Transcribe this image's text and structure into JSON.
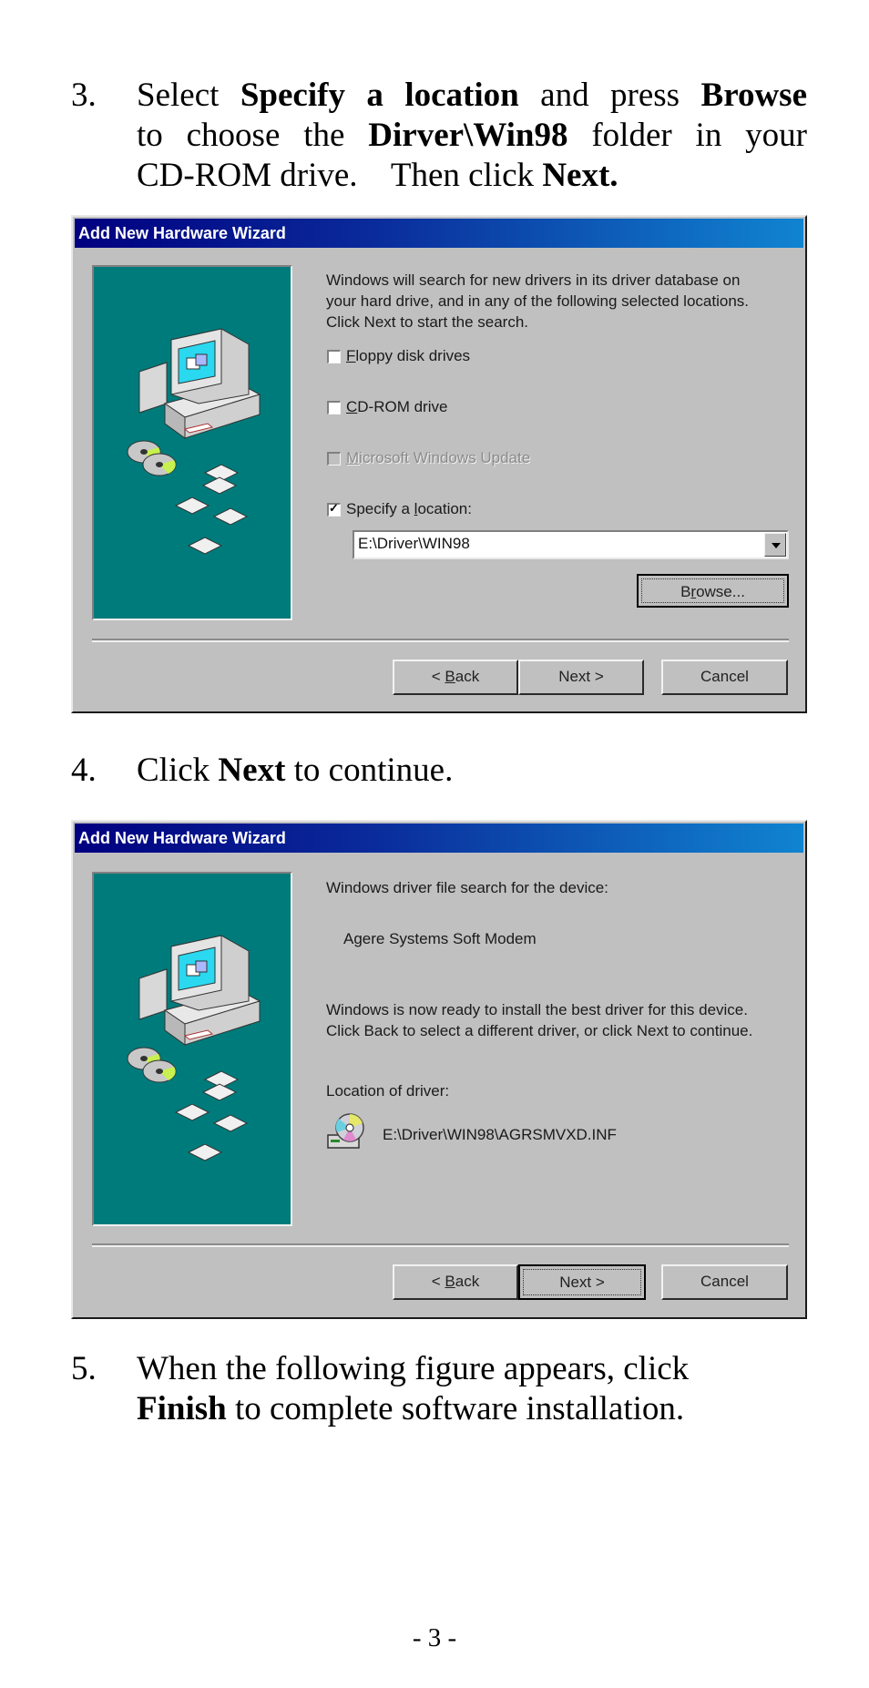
{
  "steps": [
    {
      "number": "3.",
      "lines": [
        {
          "parts": [
            {
              "t": "Select ",
              "b": false
            },
            {
              "t": "Specify a location",
              "b": true
            },
            {
              "t": " and press ",
              "b": false
            },
            {
              "t": "Browse",
              "b": true
            }
          ]
        },
        {
          "parts": [
            {
              "t": "to choose the ",
              "b": false
            },
            {
              "t": "Dirver\\Win98",
              "b": true
            },
            {
              "t": " folder in your",
              "b": false
            }
          ]
        },
        {
          "parts": [
            {
              "t": "CD-ROM drive.    Then click ",
              "b": false
            },
            {
              "t": "Next.",
              "b": true
            }
          ]
        }
      ]
    },
    {
      "number": "4.",
      "lines": [
        {
          "parts": [
            {
              "t": "Click ",
              "b": false
            },
            {
              "t": "Next",
              "b": true
            },
            {
              "t": " to continue.",
              "b": false
            }
          ]
        }
      ]
    },
    {
      "number": "5.",
      "lines": [
        {
          "parts": [
            {
              "t": "When the following figure appears, click",
              "b": false
            }
          ]
        },
        {
          "parts": [
            {
              "t": "Finish",
              "b": true
            },
            {
              "t": " to complete software installation.",
              "b": false
            }
          ]
        }
      ]
    }
  ],
  "dialog1": {
    "title": "Add New Hardware Wizard",
    "intro_lines": [
      "Windows will search for new drivers in its driver database on",
      "your hard drive, and in any of the following selected locations.",
      "Click Next to start the search."
    ],
    "options": [
      {
        "label_pre": "",
        "accel": "F",
        "label_post": "loppy disk drives",
        "checked": false,
        "disabled": false
      },
      {
        "label_pre": "",
        "accel": "C",
        "label_post": "D-ROM drive",
        "checked": false,
        "disabled": false
      },
      {
        "label_pre": "",
        "accel": "M",
        "label_post": "icrosoft Windows Update",
        "checked": false,
        "disabled": true
      },
      {
        "label_pre": "Specify a ",
        "accel": "l",
        "label_post": "ocation:",
        "checked": true,
        "disabled": false
      }
    ],
    "location_value": "E:\\Driver\\WIN98",
    "browse": {
      "pre": "B",
      "accel": "r",
      "post": "owse..."
    },
    "buttons": {
      "back_symbol": "<",
      "back_accel": "B",
      "back_post": "ack",
      "next": "Next >",
      "cancel": "Cancel"
    }
  },
  "dialog2": {
    "title": "Add New Hardware Wizard",
    "search_label": "Windows driver file search for the device:",
    "device_name": "Agere Systems Soft Modem",
    "ready_lines": [
      "Windows is now ready to install the best driver for this device.",
      "Click Back to select a different driver, or click Next to continue."
    ],
    "location_label": "Location of driver:",
    "driver_path": "E:\\Driver\\WIN98\\AGRSMVXD.INF",
    "buttons": {
      "back_symbol": "<",
      "back_accel": "B",
      "back_post": "ack",
      "next": "Next >",
      "cancel": "Cancel"
    }
  },
  "colors": {
    "teal": "#007b7b",
    "dialog_bg": "#c0c0c0",
    "title_start": "#000080",
    "title_end": "#1084d0"
  },
  "footer": {
    "page_number": "- 3 -"
  }
}
